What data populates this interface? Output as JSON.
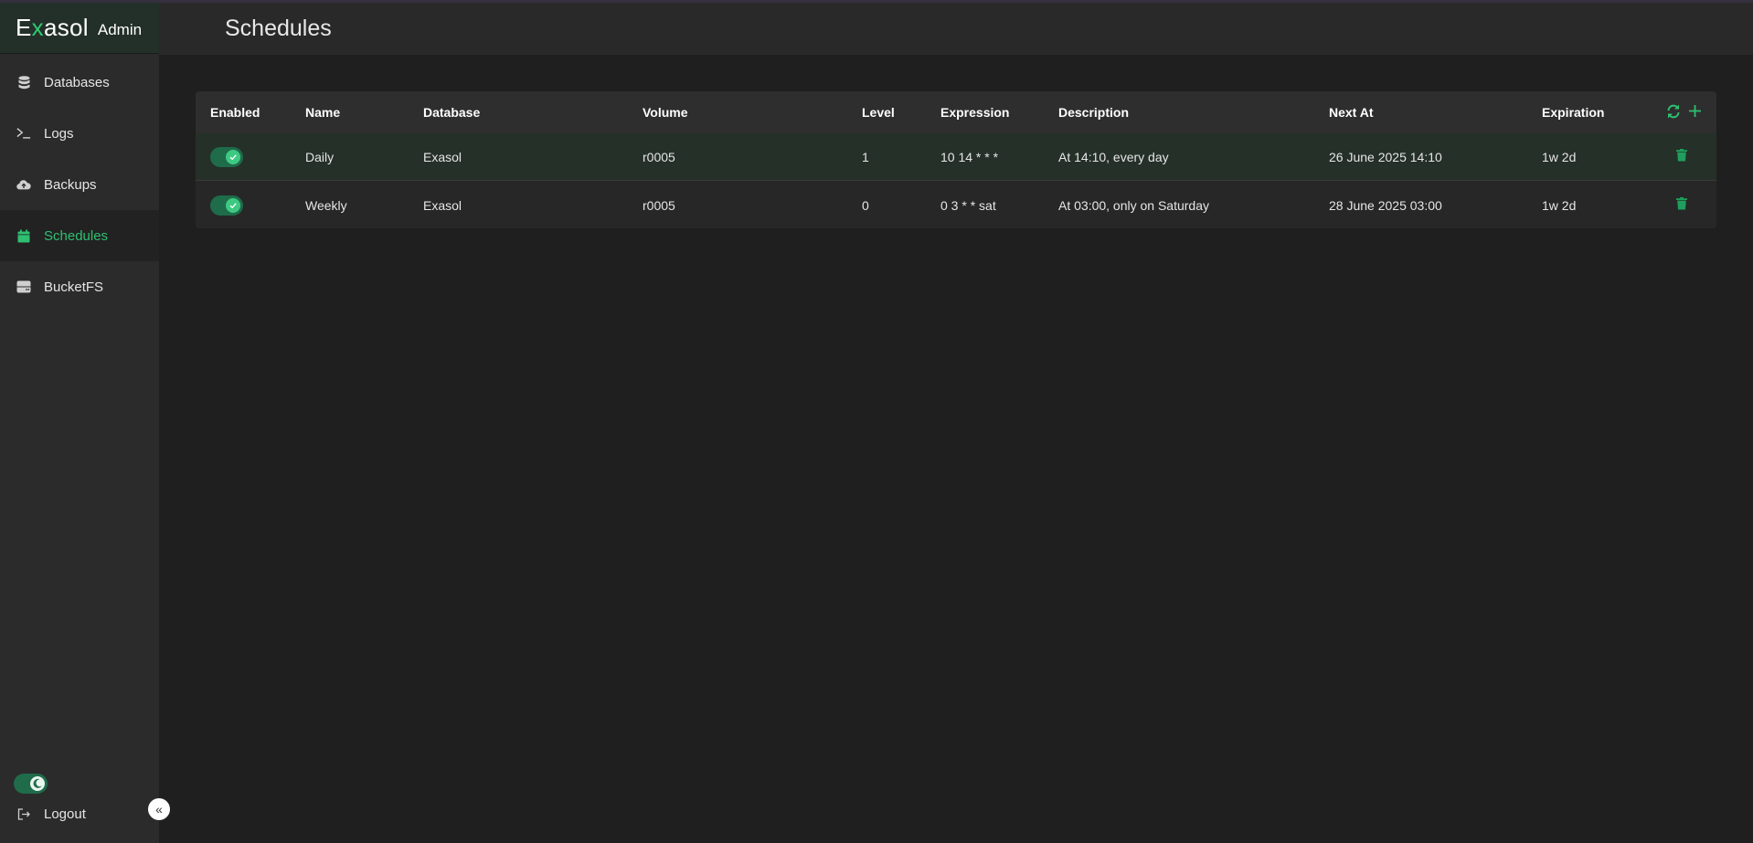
{
  "app": {
    "brand": "Exasol",
    "brand_sub": "Admin"
  },
  "sidebar": {
    "items": [
      {
        "label": "Databases",
        "icon": "database-icon"
      },
      {
        "label": "Logs",
        "icon": "terminal-icon"
      },
      {
        "label": "Backups",
        "icon": "cloud-upload-icon"
      },
      {
        "label": "Schedules",
        "icon": "calendar-icon",
        "active": true
      },
      {
        "label": "BucketFS",
        "icon": "storage-icon"
      }
    ],
    "logout": "Logout",
    "collapse_symbol": "«",
    "theme_toggle": "dark"
  },
  "header": {
    "title": "Schedules"
  },
  "table": {
    "columns": [
      "Enabled",
      "Name",
      "Database",
      "Volume",
      "Level",
      "Expression",
      "Description",
      "Next At",
      "Expiration"
    ],
    "rows": [
      {
        "enabled": true,
        "name": "Daily",
        "database": "Exasol",
        "volume": "r0005",
        "level": "1",
        "expression": "10 14 * * *",
        "description": "At 14:10, every day",
        "next_at": "26 June 2025 14:10",
        "expiration": "1w 2d"
      },
      {
        "enabled": true,
        "name": "Weekly",
        "database": "Exasol",
        "volume": "r0005",
        "level": "0",
        "expression": "0 3 * * sat",
        "description": "At 03:00, only on Saturday",
        "next_at": "28 June 2025 03:00",
        "expiration": "1w 2d"
      }
    ]
  },
  "colors": {
    "accent": "#2fbf71",
    "background": "#1f1f1f",
    "sidebar": "#2b2b2b",
    "brand_bg": "#233029"
  }
}
